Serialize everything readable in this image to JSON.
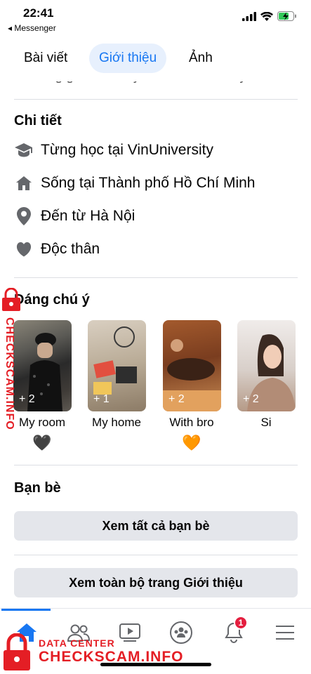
{
  "status_bar": {
    "time": "22:41",
    "back_label": "◂ Messenger"
  },
  "tabs": [
    {
      "label": "Bài viết",
      "active": false
    },
    {
      "label": "Giới thiệu",
      "active": true
    },
    {
      "label": "Ảnh",
      "active": false
    }
  ],
  "cut_text": "Letting go isn't easy but it's necessary",
  "details": {
    "title": "Chi tiết",
    "items": [
      {
        "icon": "graduation-cap-icon",
        "prefix": "Từng học tại ",
        "bold": "VinUniversity"
      },
      {
        "icon": "home-icon",
        "prefix": "Sống tại ",
        "bold": "Thành phố Hồ Chí Minh"
      },
      {
        "icon": "location-pin-icon",
        "prefix": "Đến từ ",
        "bold": "Hà Nội"
      },
      {
        "icon": "heart-icon",
        "prefix": "Độc thân",
        "bold": ""
      }
    ]
  },
  "featured": {
    "title": "Đáng chú ý",
    "items": [
      {
        "count": "+ 2",
        "label": "My room",
        "emoji": "🖤"
      },
      {
        "count": "+ 1",
        "label": "My home",
        "emoji": ""
      },
      {
        "count": "+ 2",
        "label": "With bro",
        "emoji": "🧡"
      },
      {
        "count": "+ 2",
        "label": "Si",
        "emoji": ""
      }
    ]
  },
  "friends": {
    "title": "Bạn bè",
    "see_all": "Xem tất cả bạn bè"
  },
  "see_about": "Xem toàn bộ trang Giới thiệu",
  "bottom_nav": {
    "notification_count": "1"
  },
  "watermark": {
    "line_small": "DATA CENTER",
    "line_big": "CHECKSCAM.INFO",
    "vertical": "CHECKSCAM.INFO"
  },
  "colors": {
    "accent": "#1877f2",
    "badge": "#e41e3f",
    "button_bg": "#e4e6eb",
    "watermark": "#e41e25"
  }
}
